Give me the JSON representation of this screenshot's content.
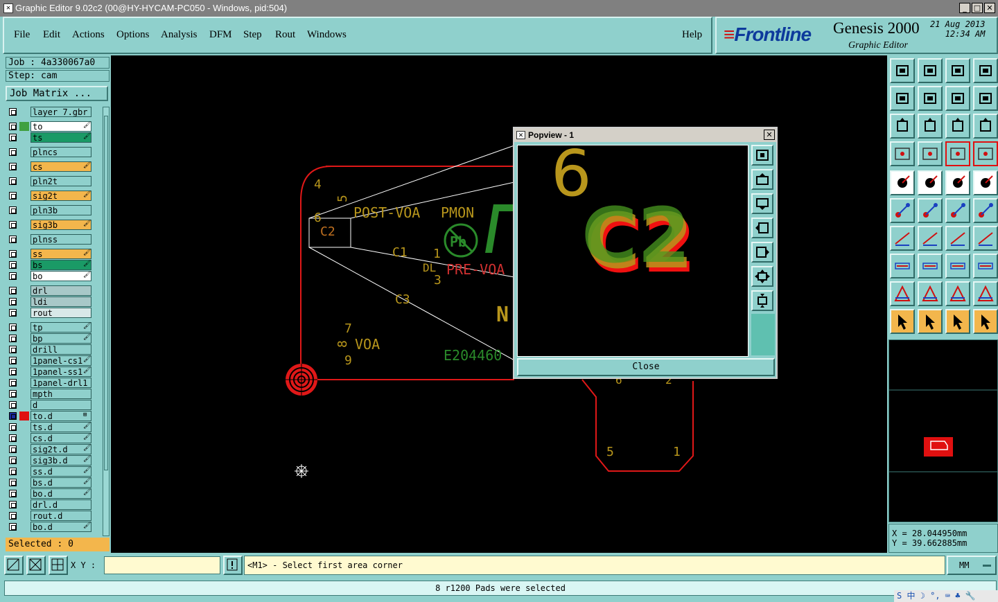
{
  "window": {
    "title": "Graphic Editor 9.02c2 (00@HY-HYCAM-PC050 - Windows, pid:504)",
    "icon_glyph": "✕"
  },
  "menu": {
    "items": [
      "File",
      "Edit",
      "Actions",
      "Options",
      "Analysis",
      "DFM",
      "Step",
      "Rout",
      "Windows"
    ],
    "help": "Help"
  },
  "brand": {
    "logo": "Frontline",
    "product": "Genesis 2000",
    "subtitle": "Graphic Editor",
    "date": "21 Aug 2013",
    "time": "12:34 AM"
  },
  "job": {
    "job_label": "Job  : 4a330067a0",
    "step_label": "Step: cam",
    "job_matrix": "Job Matrix ..."
  },
  "layers": [
    {
      "name": "layer_7.gbr",
      "color": "#8fd0cc",
      "swatch": "",
      "edit": ""
    },
    {
      "name": "to",
      "color": "#ffffff",
      "swatch": "#40a040",
      "edit": "🖌"
    },
    {
      "name": "ts",
      "color": "#1a9a66",
      "swatch": "",
      "edit": "🖌"
    },
    {
      "name": "plncs",
      "color": "#8fd0cc",
      "swatch": "",
      "edit": ""
    },
    {
      "name": "cs",
      "color": "#f3b64c",
      "swatch": "",
      "edit": "🖌"
    },
    {
      "name": "pln2t",
      "color": "#8fd0cc",
      "swatch": "",
      "edit": ""
    },
    {
      "name": "sig2t",
      "color": "#f3b64c",
      "swatch": "",
      "edit": "🖌"
    },
    {
      "name": "pln3b",
      "color": "#8fd0cc",
      "swatch": "",
      "edit": ""
    },
    {
      "name": "sig3b",
      "color": "#f3b64c",
      "swatch": "",
      "edit": "🖌"
    },
    {
      "name": "plnss",
      "color": "#8fd0cc",
      "swatch": "",
      "edit": ""
    },
    {
      "name": "ss",
      "color": "#f3b64c",
      "swatch": "",
      "edit": "🖌"
    },
    {
      "name": "bs",
      "color": "#1a9a66",
      "swatch": "",
      "edit": "🖌"
    },
    {
      "name": "bo",
      "color": "#ffffff",
      "swatch": "",
      "edit": "🖌"
    },
    {
      "name": "drl",
      "color": "#a8c8c8",
      "swatch": "",
      "edit": ""
    },
    {
      "name": "ldi",
      "color": "#a8c8c8",
      "swatch": "",
      "edit": ""
    },
    {
      "name": "rout",
      "color": "#d8e8e8",
      "swatch": "",
      "edit": ""
    },
    {
      "name": "tp",
      "color": "#8fd0cc",
      "swatch": "",
      "edit": "🖌"
    },
    {
      "name": "bp",
      "color": "#8fd0cc",
      "swatch": "",
      "edit": "🖌"
    },
    {
      "name": "drill",
      "color": "#8fd0cc",
      "swatch": "",
      "edit": ""
    },
    {
      "name": "1panel-cs1",
      "color": "#8fd0cc",
      "swatch": "",
      "edit": "🖌"
    },
    {
      "name": "1panel-ss1",
      "color": "#8fd0cc",
      "swatch": "",
      "edit": "🖌"
    },
    {
      "name": "1panel-drl1",
      "color": "#8fd0cc",
      "swatch": "",
      "edit": ""
    },
    {
      "name": "mpth",
      "color": "#8fd0cc",
      "swatch": "",
      "edit": ""
    },
    {
      "name": "d",
      "color": "#8fd0cc",
      "swatch": "",
      "edit": ""
    },
    {
      "name": "to.d",
      "color": "#8fd0cc",
      "swatch": "#e01010",
      "edit": "⊞"
    },
    {
      "name": "ts.d",
      "color": "#8fd0cc",
      "swatch": "",
      "edit": "🖌"
    },
    {
      "name": "cs.d",
      "color": "#8fd0cc",
      "swatch": "",
      "edit": "🖌"
    },
    {
      "name": "sig2t.d",
      "color": "#8fd0cc",
      "swatch": "",
      "edit": "🖌"
    },
    {
      "name": "sig3b.d",
      "color": "#8fd0cc",
      "swatch": "",
      "edit": "🖌"
    },
    {
      "name": "ss.d",
      "color": "#8fd0cc",
      "swatch": "",
      "edit": "🖌"
    },
    {
      "name": "bs.d",
      "color": "#8fd0cc",
      "swatch": "",
      "edit": "🖌"
    },
    {
      "name": "bo.d",
      "color": "#8fd0cc",
      "swatch": "",
      "edit": "🖌"
    },
    {
      "name": "drl.d",
      "color": "#8fd0cc",
      "swatch": "",
      "edit": ""
    },
    {
      "name": "rout.d",
      "color": "#8fd0cc",
      "swatch": "",
      "edit": ""
    },
    {
      "name": "bo.d",
      "color": "#8fd0cc",
      "swatch": "",
      "edit": "🖌"
    }
  ],
  "selected_label": "Selected : 0",
  "canvas": {
    "silk_texts": [
      "4",
      "5",
      "6",
      "C2",
      "POST-VOA",
      "PMON",
      "C1",
      "1",
      "DL",
      "3",
      "PRE-VOA",
      "C3",
      "7",
      "8",
      "9",
      "VOA",
      "E204460",
      "N",
      "Pb",
      "6",
      "2",
      "5",
      "1"
    ]
  },
  "popview": {
    "title": "Popview - 1",
    "close_label": "Close",
    "zoom_texts": [
      "6",
      "C2"
    ]
  },
  "coords": {
    "x_label": "X = 28.044950mm",
    "y_label": "Y = 39.662885mm"
  },
  "bottom": {
    "xy_label": "X Y :",
    "xy_value": "",
    "prompt": "<M1> - Select first area corner",
    "unit": "MM",
    "status": "8 r1200 Pads were selected"
  },
  "tray": {
    "text": "S 中 ☽ °, ⌨ ♣ 🔧"
  },
  "colors": {
    "panel": "#8fd0cc",
    "silk": "#b8961c",
    "board_outline": "#e01818",
    "green": "#2a8a2a",
    "orange": "#f3b64c"
  }
}
